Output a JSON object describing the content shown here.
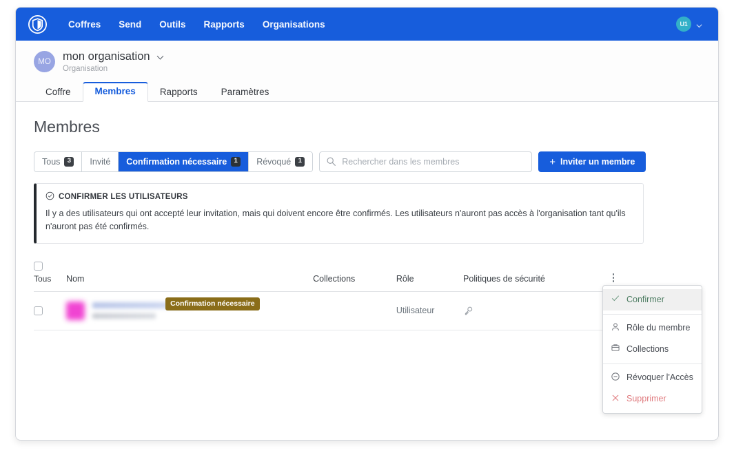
{
  "navbar": {
    "brand_icon": "bitwarden-shield-logo",
    "links": [
      {
        "label": "Coffres"
      },
      {
        "label": "Send"
      },
      {
        "label": "Outils"
      },
      {
        "label": "Rapports"
      },
      {
        "label": "Organisations"
      }
    ],
    "account": {
      "avatar_initials": "U1",
      "avatar_color": "#33b0c8",
      "caret_icon": "chevron-down-icon"
    },
    "background_color": "#175ddc"
  },
  "organization": {
    "avatar_initials": "MO",
    "avatar_color": "#98a5e3",
    "name": "mon organisation",
    "subtitle": "Organisation",
    "chevron_icon": "chevron-down-icon"
  },
  "tabs": [
    {
      "label": "Coffre",
      "active": false
    },
    {
      "label": "Membres",
      "active": true
    },
    {
      "label": "Rapports",
      "active": false
    },
    {
      "label": "Paramètres",
      "active": false
    }
  ],
  "page": {
    "title": "Membres"
  },
  "filters": [
    {
      "label": "Tous",
      "count": "3",
      "active": false
    },
    {
      "label": "Invité",
      "count": "",
      "active": false
    },
    {
      "label": "Confirmation nécessaire",
      "count": "1",
      "active": true
    },
    {
      "label": "Révoqué",
      "count": "1",
      "active": false
    }
  ],
  "search": {
    "placeholder": "Rechercher dans les membres",
    "value": "",
    "icon": "search-icon"
  },
  "invite_button": {
    "label": "Inviter un membre",
    "icon": "plus-icon",
    "color": "#175ddc"
  },
  "callout": {
    "icon": "check-circle-icon",
    "title": "CONFIRMER LES UTILISATEURS",
    "body": "Il y a des utilisateurs qui ont accepté leur invitation, mais qui doivent encore être confirmés. Les utilisateurs n'auront pas accès à l'organisation tant qu'ils n'auront pas été confirmés.",
    "accent_color": "#24292e"
  },
  "table": {
    "select_all_label": "Tous",
    "headers": {
      "name": "Nom",
      "collections": "Collections",
      "role": "Rôle",
      "policies": "Politiques de sécurité",
      "menu_icon": "vertical-dots-icon"
    },
    "rows": [
      {
        "name": "",
        "email": "",
        "status_badge": "Confirmation nécessaire",
        "status_badge_color": "#8a6d19",
        "collections": "",
        "role": "Utilisateur",
        "policy_icon": "key-icon",
        "menu_icon": "vertical-dots-icon"
      }
    ]
  },
  "dropdown": {
    "sections": [
      {
        "items": [
          {
            "label": "Confirmer",
            "icon": "check-icon",
            "highlighted": true,
            "danger": false
          }
        ]
      },
      {
        "items": [
          {
            "label": "Rôle du membre",
            "icon": "user-icon",
            "highlighted": false,
            "danger": false
          },
          {
            "label": "Collections",
            "icon": "folder-icon",
            "highlighted": false,
            "danger": false
          }
        ]
      },
      {
        "items": [
          {
            "label": "Révoquer l'Accès",
            "icon": "minus-circle-icon",
            "highlighted": false,
            "danger": false
          },
          {
            "label": "Supprimer",
            "icon": "close-x-icon",
            "highlighted": false,
            "danger": true
          }
        ]
      }
    ]
  }
}
